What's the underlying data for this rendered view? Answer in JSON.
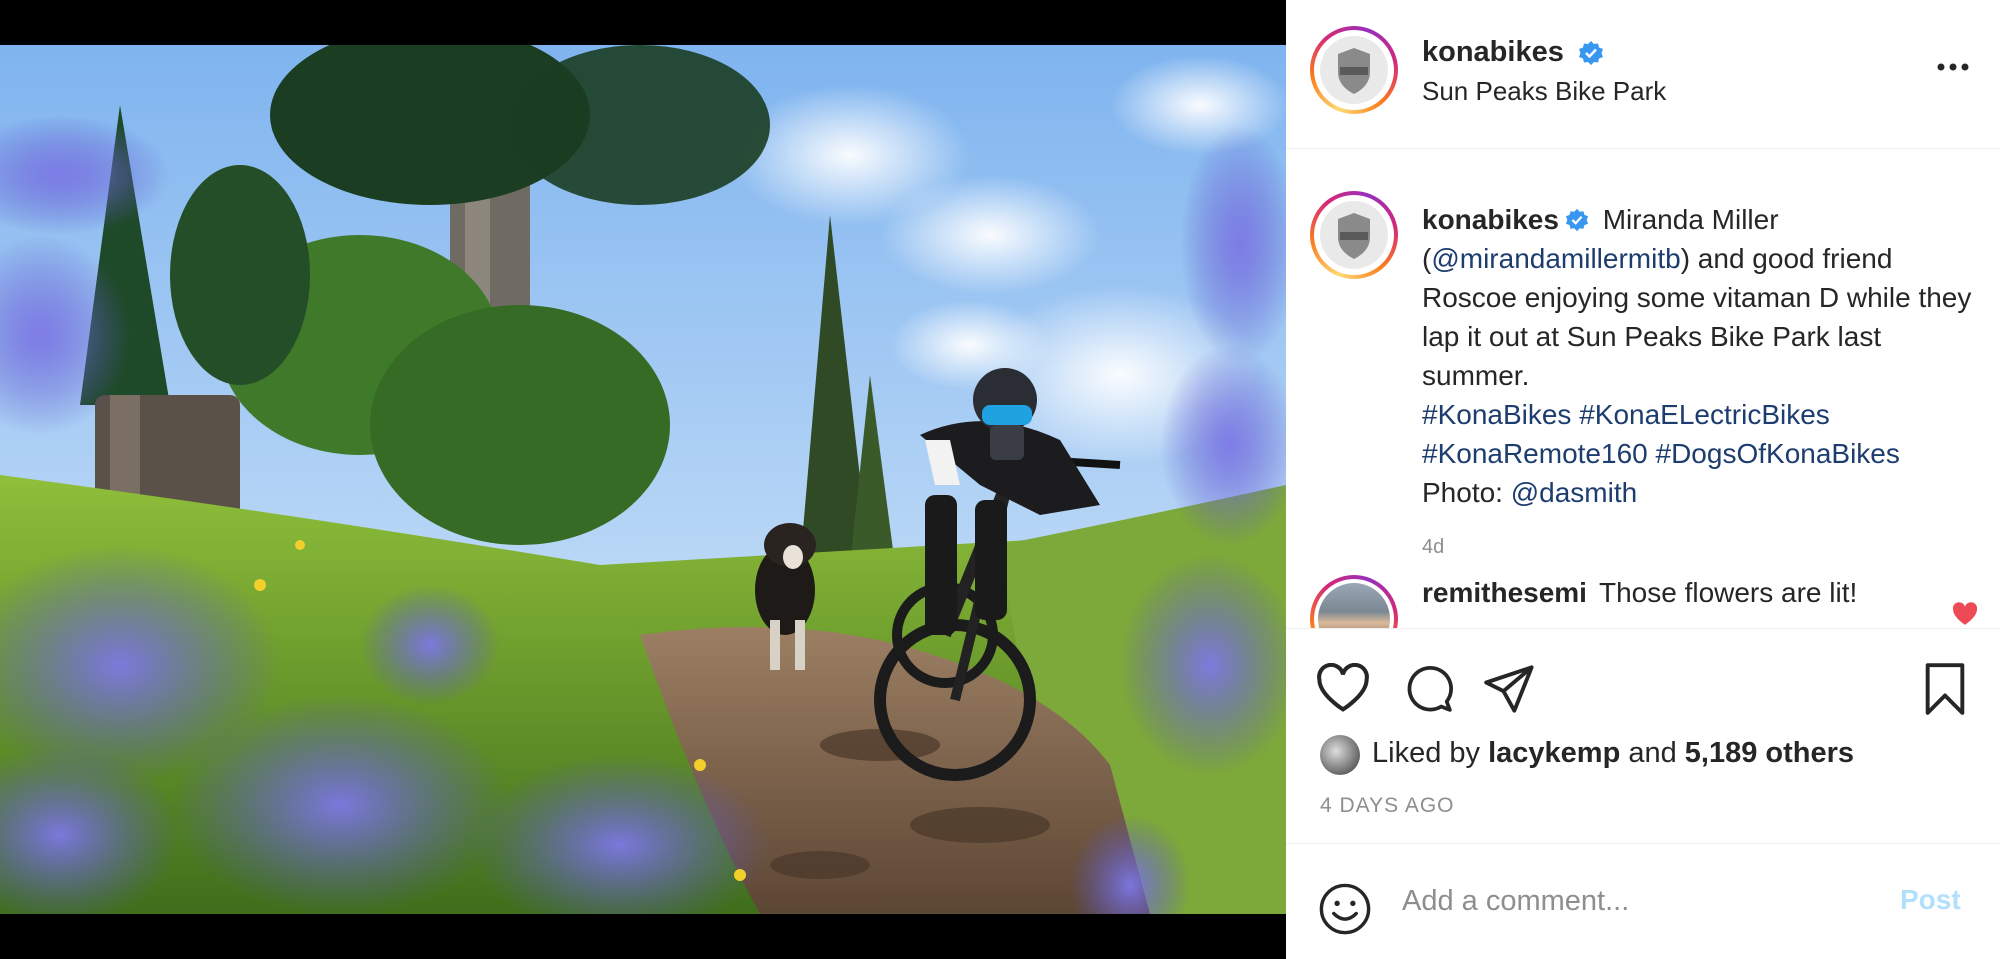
{
  "post": {
    "username": "konabikes",
    "location": "Sun Peaks Bike Park",
    "verified_icon": "verified-badge-icon",
    "more_icon": "more-options-icon"
  },
  "caption": {
    "username": "konabikes",
    "text_1": " Miranda Miller (",
    "mention_1": "@mirandamillermitb",
    "text_2": ") and good friend Roscoe enjoying some vitaman D while they lap it out at Sun Peaks Bike Park last summer.",
    "hashtags": [
      "#KonaBikes",
      "#KonaELectricBikes",
      "#KonaRemote160",
      "#DogsOfKonaBikes"
    ],
    "photo_credit_label": "Photo: ",
    "photo_credit_mention": "@dasmith",
    "time": "4d"
  },
  "comments": [
    {
      "username": "remithesemi",
      "text": "Those flowers are lit!",
      "liked": true
    }
  ],
  "actions": {
    "like_icon": "heart-icon",
    "comment_icon": "comment-bubble-icon",
    "share_icon": "paper-plane-icon",
    "save_icon": "bookmark-icon"
  },
  "likes": {
    "prefix": "Liked by ",
    "first_liker": "lacykemp",
    "middle": " and ",
    "others": "5,189 others"
  },
  "date": "4 DAYS AGO",
  "add_comment": {
    "placeholder": "Add a comment...",
    "post_label": "Post",
    "emoji_icon": "emoji-smile-icon"
  },
  "colors": {
    "link": "#1d3d6f",
    "verified": "#3897f0",
    "liked_heart": "#ed4956",
    "post_disabled": "#b2dffc",
    "muted": "#8e8e8e"
  }
}
